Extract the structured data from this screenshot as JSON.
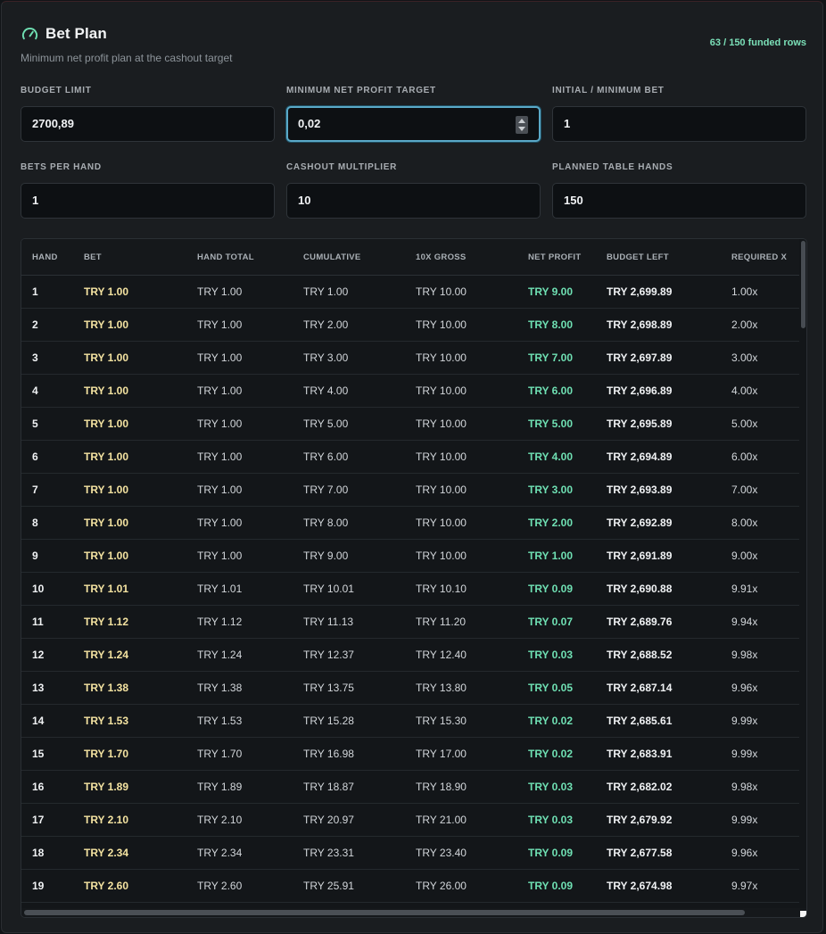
{
  "header": {
    "title": "Bet Plan",
    "subtitle": "Minimum net profit plan at the cashout target",
    "funded": "63 / 150 funded rows"
  },
  "fields": [
    {
      "label": "BUDGET LIMIT",
      "value": "2700,89"
    },
    {
      "label": "MINIMUM NET PROFIT TARGET",
      "value": "0,02"
    },
    {
      "label": "INITIAL / MINIMUM BET",
      "value": "1"
    },
    {
      "label": "BETS PER HAND",
      "value": "1"
    },
    {
      "label": "CASHOUT MULTIPLIER",
      "value": "10"
    },
    {
      "label": "PLANNED TABLE HANDS",
      "value": "150"
    }
  ],
  "table": {
    "headers": [
      "HAND",
      "BET",
      "HAND TOTAL",
      "CUMULATIVE",
      "10X GROSS",
      "NET PROFIT",
      "BUDGET LEFT",
      "REQUIRED X"
    ],
    "rows": [
      [
        "1",
        "TRY 1.00",
        "TRY 1.00",
        "TRY 1.00",
        "TRY 10.00",
        "TRY 9.00",
        "TRY 2,699.89",
        "1.00x"
      ],
      [
        "2",
        "TRY 1.00",
        "TRY 1.00",
        "TRY 2.00",
        "TRY 10.00",
        "TRY 8.00",
        "TRY 2,698.89",
        "2.00x"
      ],
      [
        "3",
        "TRY 1.00",
        "TRY 1.00",
        "TRY 3.00",
        "TRY 10.00",
        "TRY 7.00",
        "TRY 2,697.89",
        "3.00x"
      ],
      [
        "4",
        "TRY 1.00",
        "TRY 1.00",
        "TRY 4.00",
        "TRY 10.00",
        "TRY 6.00",
        "TRY 2,696.89",
        "4.00x"
      ],
      [
        "5",
        "TRY 1.00",
        "TRY 1.00",
        "TRY 5.00",
        "TRY 10.00",
        "TRY 5.00",
        "TRY 2,695.89",
        "5.00x"
      ],
      [
        "6",
        "TRY 1.00",
        "TRY 1.00",
        "TRY 6.00",
        "TRY 10.00",
        "TRY 4.00",
        "TRY 2,694.89",
        "6.00x"
      ],
      [
        "7",
        "TRY 1.00",
        "TRY 1.00",
        "TRY 7.00",
        "TRY 10.00",
        "TRY 3.00",
        "TRY 2,693.89",
        "7.00x"
      ],
      [
        "8",
        "TRY 1.00",
        "TRY 1.00",
        "TRY 8.00",
        "TRY 10.00",
        "TRY 2.00",
        "TRY 2,692.89",
        "8.00x"
      ],
      [
        "9",
        "TRY 1.00",
        "TRY 1.00",
        "TRY 9.00",
        "TRY 10.00",
        "TRY 1.00",
        "TRY 2,691.89",
        "9.00x"
      ],
      [
        "10",
        "TRY 1.01",
        "TRY 1.01",
        "TRY 10.01",
        "TRY 10.10",
        "TRY 0.09",
        "TRY 2,690.88",
        "9.91x"
      ],
      [
        "11",
        "TRY 1.12",
        "TRY 1.12",
        "TRY 11.13",
        "TRY 11.20",
        "TRY 0.07",
        "TRY 2,689.76",
        "9.94x"
      ],
      [
        "12",
        "TRY 1.24",
        "TRY 1.24",
        "TRY 12.37",
        "TRY 12.40",
        "TRY 0.03",
        "TRY 2,688.52",
        "9.98x"
      ],
      [
        "13",
        "TRY 1.38",
        "TRY 1.38",
        "TRY 13.75",
        "TRY 13.80",
        "TRY 0.05",
        "TRY 2,687.14",
        "9.96x"
      ],
      [
        "14",
        "TRY 1.53",
        "TRY 1.53",
        "TRY 15.28",
        "TRY 15.30",
        "TRY 0.02",
        "TRY 2,685.61",
        "9.99x"
      ],
      [
        "15",
        "TRY 1.70",
        "TRY 1.70",
        "TRY 16.98",
        "TRY 17.00",
        "TRY 0.02",
        "TRY 2,683.91",
        "9.99x"
      ],
      [
        "16",
        "TRY 1.89",
        "TRY 1.89",
        "TRY 18.87",
        "TRY 18.90",
        "TRY 0.03",
        "TRY 2,682.02",
        "9.98x"
      ],
      [
        "17",
        "TRY 2.10",
        "TRY 2.10",
        "TRY 20.97",
        "TRY 21.00",
        "TRY 0.03",
        "TRY 2,679.92",
        "9.99x"
      ],
      [
        "18",
        "TRY 2.34",
        "TRY 2.34",
        "TRY 23.31",
        "TRY 23.40",
        "TRY 0.09",
        "TRY 2,677.58",
        "9.96x"
      ],
      [
        "19",
        "TRY 2.60",
        "TRY 2.60",
        "TRY 25.91",
        "TRY 26.00",
        "TRY 0.09",
        "TRY 2,674.98",
        "9.97x"
      ]
    ]
  },
  "colors": {
    "accent_green": "#6fe0b3",
    "bet_yellow": "#f4e3a1",
    "focus_blue": "#5aa9c8"
  },
  "icons": {
    "title": "gauge-icon"
  }
}
